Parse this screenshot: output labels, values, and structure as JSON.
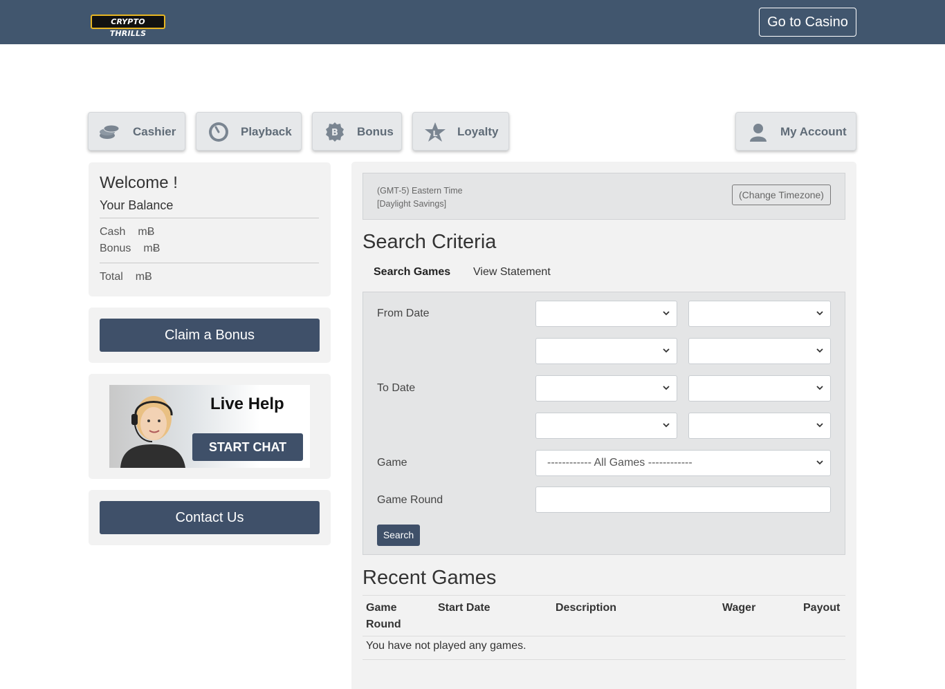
{
  "header": {
    "logo_text": "CRYPTO THRILLS",
    "casino_button": "Go to Casino"
  },
  "nav": {
    "cashier": "Cashier",
    "playback": "Playback",
    "bonus": "Bonus",
    "loyalty": "Loyalty",
    "my_account": "My Account"
  },
  "balance": {
    "welcome": "Welcome !",
    "your_balance": "Your Balance",
    "cash_label": "Cash",
    "cash_value": "mɃ",
    "bonus_label": "Bonus",
    "bonus_value": "mɃ",
    "total_label": "Total",
    "total_value": "mɃ"
  },
  "sidebar": {
    "claim_bonus": "Claim a Bonus",
    "live_help": "Live Help",
    "start_chat": "START CHAT",
    "contact_us": "Contact Us"
  },
  "timezone": {
    "line1": "(GMT-5) Eastern Time",
    "line2": "[Daylight Savings]",
    "change": "(Change Timezone)"
  },
  "search": {
    "title": "Search Criteria",
    "tabs": [
      "Search Games",
      "View Statement"
    ],
    "from_date": "From Date",
    "to_date": "To Date",
    "game": "Game",
    "game_select": "------------ All Games ------------",
    "game_round": "Game Round",
    "game_round_value": "",
    "search_button": "Search"
  },
  "recent": {
    "title": "Recent Games",
    "columns": [
      "Game Round",
      "Start Date",
      "Description",
      "Wager",
      "Payout"
    ],
    "empty": "You have not played any games."
  },
  "colors": {
    "header_bg": "#41566e",
    "button_dark": "#3f5069",
    "panel_bg": "#f2f2f2"
  }
}
